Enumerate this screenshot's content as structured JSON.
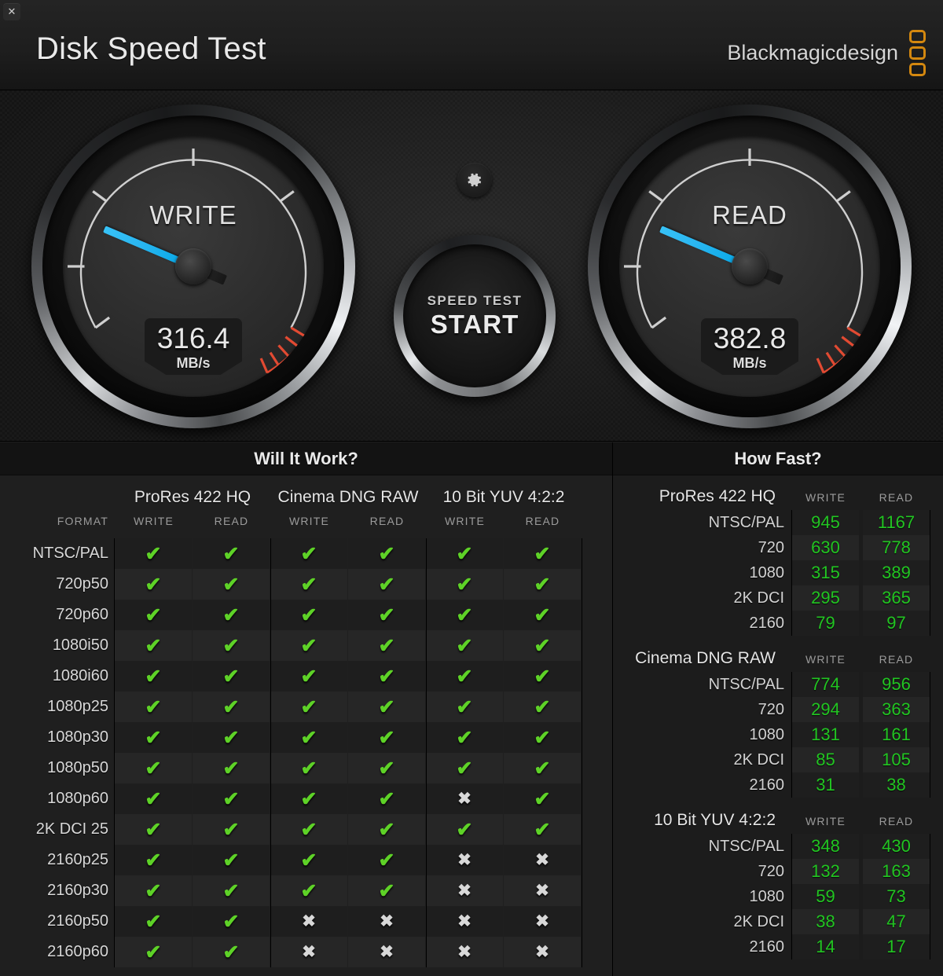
{
  "window": {
    "close_label": "✕",
    "title": "Disk Speed Test",
    "brand": "Blackmagicdesign"
  },
  "gauges": {
    "write": {
      "label": "WRITE",
      "value": "316.4",
      "unit": "MB/s",
      "needle_deg": 203,
      "color": "#2ab6f0"
    },
    "read": {
      "label": "READ",
      "value": "382.8",
      "unit": "MB/s",
      "needle_deg": 203,
      "color": "#2ab6f0"
    },
    "redzone_color": "#e24a32",
    "scale_color": "#d5d5d5"
  },
  "center": {
    "gear_icon": "gear-icon",
    "start_sub": "SPEED TEST",
    "start_main": "START"
  },
  "will_it_work": {
    "title": "Will It Work?",
    "format_header": "FORMAT",
    "codecs": [
      "ProRes 422 HQ",
      "Cinema DNG RAW",
      "10 Bit YUV 4:2:2"
    ],
    "sub_headers": [
      "WRITE",
      "READ",
      "WRITE",
      "READ",
      "WRITE",
      "READ"
    ],
    "yes_glyph": "✔",
    "no_glyph": "✖",
    "yes_color": "#5ed227",
    "no_color": "#d8d8d8",
    "rows": [
      {
        "format": "NTSC/PAL",
        "cells": [
          true,
          true,
          true,
          true,
          true,
          true
        ]
      },
      {
        "format": "720p50",
        "cells": [
          true,
          true,
          true,
          true,
          true,
          true
        ]
      },
      {
        "format": "720p60",
        "cells": [
          true,
          true,
          true,
          true,
          true,
          true
        ]
      },
      {
        "format": "1080i50",
        "cells": [
          true,
          true,
          true,
          true,
          true,
          true
        ]
      },
      {
        "format": "1080i60",
        "cells": [
          true,
          true,
          true,
          true,
          true,
          true
        ]
      },
      {
        "format": "1080p25",
        "cells": [
          true,
          true,
          true,
          true,
          true,
          true
        ]
      },
      {
        "format": "1080p30",
        "cells": [
          true,
          true,
          true,
          true,
          true,
          true
        ]
      },
      {
        "format": "1080p50",
        "cells": [
          true,
          true,
          true,
          true,
          true,
          true
        ]
      },
      {
        "format": "1080p60",
        "cells": [
          true,
          true,
          true,
          true,
          false,
          true
        ]
      },
      {
        "format": "2K DCI 25",
        "cells": [
          true,
          true,
          true,
          true,
          true,
          true
        ]
      },
      {
        "format": "2160p25",
        "cells": [
          true,
          true,
          true,
          true,
          false,
          false
        ]
      },
      {
        "format": "2160p30",
        "cells": [
          true,
          true,
          true,
          true,
          false,
          false
        ]
      },
      {
        "format": "2160p50",
        "cells": [
          true,
          true,
          false,
          false,
          false,
          false
        ]
      },
      {
        "format": "2160p60",
        "cells": [
          true,
          true,
          false,
          false,
          false,
          false
        ]
      }
    ]
  },
  "how_fast": {
    "title": "How Fast?",
    "write_header": "WRITE",
    "read_header": "READ",
    "value_color": "#22c522",
    "sections": [
      {
        "name": "ProRes 422 HQ",
        "rows": [
          {
            "label": "NTSC/PAL",
            "write": "945",
            "read": "1167"
          },
          {
            "label": "720",
            "write": "630",
            "read": "778"
          },
          {
            "label": "1080",
            "write": "315",
            "read": "389"
          },
          {
            "label": "2K DCI",
            "write": "295",
            "read": "365"
          },
          {
            "label": "2160",
            "write": "79",
            "read": "97"
          }
        ]
      },
      {
        "name": "Cinema DNG RAW",
        "rows": [
          {
            "label": "NTSC/PAL",
            "write": "774",
            "read": "956"
          },
          {
            "label": "720",
            "write": "294",
            "read": "363"
          },
          {
            "label": "1080",
            "write": "131",
            "read": "161"
          },
          {
            "label": "2K DCI",
            "write": "85",
            "read": "105"
          },
          {
            "label": "2160",
            "write": "31",
            "read": "38"
          }
        ]
      },
      {
        "name": "10 Bit YUV 4:2:2",
        "rows": [
          {
            "label": "NTSC/PAL",
            "write": "348",
            "read": "430"
          },
          {
            "label": "720",
            "write": "132",
            "read": "163"
          },
          {
            "label": "1080",
            "write": "59",
            "read": "73"
          },
          {
            "label": "2K DCI",
            "write": "38",
            "read": "47"
          },
          {
            "label": "2160",
            "write": "14",
            "read": "17"
          }
        ]
      }
    ]
  }
}
